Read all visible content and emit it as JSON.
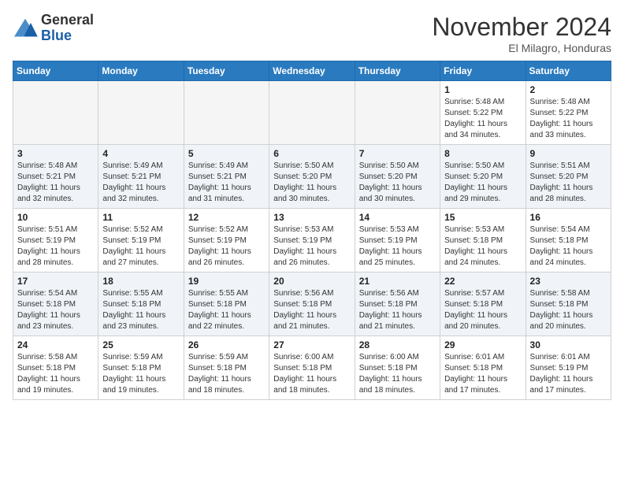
{
  "header": {
    "logo_general": "General",
    "logo_blue": "Blue",
    "month_title": "November 2024",
    "location": "El Milagro, Honduras"
  },
  "days_of_week": [
    "Sunday",
    "Monday",
    "Tuesday",
    "Wednesday",
    "Thursday",
    "Friday",
    "Saturday"
  ],
  "weeks": [
    [
      {
        "day": "",
        "info": ""
      },
      {
        "day": "",
        "info": ""
      },
      {
        "day": "",
        "info": ""
      },
      {
        "day": "",
        "info": ""
      },
      {
        "day": "",
        "info": ""
      },
      {
        "day": "1",
        "info": "Sunrise: 5:48 AM\nSunset: 5:22 PM\nDaylight: 11 hours\nand 34 minutes."
      },
      {
        "day": "2",
        "info": "Sunrise: 5:48 AM\nSunset: 5:22 PM\nDaylight: 11 hours\nand 33 minutes."
      }
    ],
    [
      {
        "day": "3",
        "info": "Sunrise: 5:48 AM\nSunset: 5:21 PM\nDaylight: 11 hours\nand 32 minutes."
      },
      {
        "day": "4",
        "info": "Sunrise: 5:49 AM\nSunset: 5:21 PM\nDaylight: 11 hours\nand 32 minutes."
      },
      {
        "day": "5",
        "info": "Sunrise: 5:49 AM\nSunset: 5:21 PM\nDaylight: 11 hours\nand 31 minutes."
      },
      {
        "day": "6",
        "info": "Sunrise: 5:50 AM\nSunset: 5:20 PM\nDaylight: 11 hours\nand 30 minutes."
      },
      {
        "day": "7",
        "info": "Sunrise: 5:50 AM\nSunset: 5:20 PM\nDaylight: 11 hours\nand 30 minutes."
      },
      {
        "day": "8",
        "info": "Sunrise: 5:50 AM\nSunset: 5:20 PM\nDaylight: 11 hours\nand 29 minutes."
      },
      {
        "day": "9",
        "info": "Sunrise: 5:51 AM\nSunset: 5:20 PM\nDaylight: 11 hours\nand 28 minutes."
      }
    ],
    [
      {
        "day": "10",
        "info": "Sunrise: 5:51 AM\nSunset: 5:19 PM\nDaylight: 11 hours\nand 28 minutes."
      },
      {
        "day": "11",
        "info": "Sunrise: 5:52 AM\nSunset: 5:19 PM\nDaylight: 11 hours\nand 27 minutes."
      },
      {
        "day": "12",
        "info": "Sunrise: 5:52 AM\nSunset: 5:19 PM\nDaylight: 11 hours\nand 26 minutes."
      },
      {
        "day": "13",
        "info": "Sunrise: 5:53 AM\nSunset: 5:19 PM\nDaylight: 11 hours\nand 26 minutes."
      },
      {
        "day": "14",
        "info": "Sunrise: 5:53 AM\nSunset: 5:19 PM\nDaylight: 11 hours\nand 25 minutes."
      },
      {
        "day": "15",
        "info": "Sunrise: 5:53 AM\nSunset: 5:18 PM\nDaylight: 11 hours\nand 24 minutes."
      },
      {
        "day": "16",
        "info": "Sunrise: 5:54 AM\nSunset: 5:18 PM\nDaylight: 11 hours\nand 24 minutes."
      }
    ],
    [
      {
        "day": "17",
        "info": "Sunrise: 5:54 AM\nSunset: 5:18 PM\nDaylight: 11 hours\nand 23 minutes."
      },
      {
        "day": "18",
        "info": "Sunrise: 5:55 AM\nSunset: 5:18 PM\nDaylight: 11 hours\nand 23 minutes."
      },
      {
        "day": "19",
        "info": "Sunrise: 5:55 AM\nSunset: 5:18 PM\nDaylight: 11 hours\nand 22 minutes."
      },
      {
        "day": "20",
        "info": "Sunrise: 5:56 AM\nSunset: 5:18 PM\nDaylight: 11 hours\nand 21 minutes."
      },
      {
        "day": "21",
        "info": "Sunrise: 5:56 AM\nSunset: 5:18 PM\nDaylight: 11 hours\nand 21 minutes."
      },
      {
        "day": "22",
        "info": "Sunrise: 5:57 AM\nSunset: 5:18 PM\nDaylight: 11 hours\nand 20 minutes."
      },
      {
        "day": "23",
        "info": "Sunrise: 5:58 AM\nSunset: 5:18 PM\nDaylight: 11 hours\nand 20 minutes."
      }
    ],
    [
      {
        "day": "24",
        "info": "Sunrise: 5:58 AM\nSunset: 5:18 PM\nDaylight: 11 hours\nand 19 minutes."
      },
      {
        "day": "25",
        "info": "Sunrise: 5:59 AM\nSunset: 5:18 PM\nDaylight: 11 hours\nand 19 minutes."
      },
      {
        "day": "26",
        "info": "Sunrise: 5:59 AM\nSunset: 5:18 PM\nDaylight: 11 hours\nand 18 minutes."
      },
      {
        "day": "27",
        "info": "Sunrise: 6:00 AM\nSunset: 5:18 PM\nDaylight: 11 hours\nand 18 minutes."
      },
      {
        "day": "28",
        "info": "Sunrise: 6:00 AM\nSunset: 5:18 PM\nDaylight: 11 hours\nand 18 minutes."
      },
      {
        "day": "29",
        "info": "Sunrise: 6:01 AM\nSunset: 5:18 PM\nDaylight: 11 hours\nand 17 minutes."
      },
      {
        "day": "30",
        "info": "Sunrise: 6:01 AM\nSunset: 5:19 PM\nDaylight: 11 hours\nand 17 minutes."
      }
    ]
  ]
}
